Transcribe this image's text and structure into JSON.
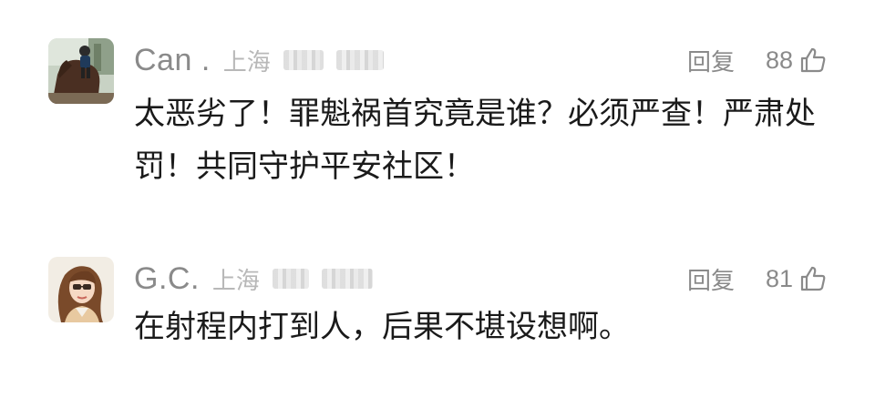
{
  "comments": [
    {
      "username": "Can .",
      "location": "上海",
      "reply_label": "回复",
      "likes": "88",
      "text": "太恶劣了！罪魁祸首究竟是谁？必须严查！严肃处罚！共同守护平安社区！"
    },
    {
      "username": "G.C.",
      "location": "上海",
      "reply_label": "回复",
      "likes": "81",
      "text": "在射程内打到人，后果不堪设想啊。"
    }
  ],
  "colors": {
    "meta_gray": "#8a8a8a",
    "location_gray": "#b8b8b8",
    "body_text": "#1a1a1a"
  }
}
